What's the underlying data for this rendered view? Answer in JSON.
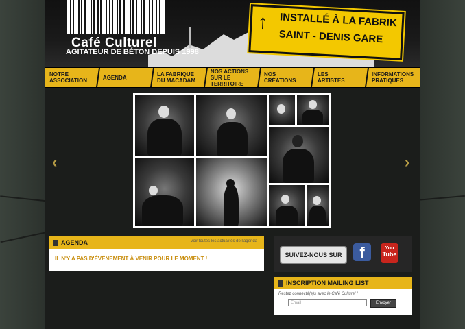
{
  "header": {
    "logo_main": "Café Culturel",
    "logo_sub": "AGITATEUR DE BÉTON DEPUIS 1998",
    "sign_line1": "INSTALLÉ À LA FABRIK",
    "sign_line2": "SAINT - DENIS GARE",
    "sign_arrow": "↑"
  },
  "nav": {
    "items": [
      {
        "label": "NOTRE ASSOCIATION"
      },
      {
        "label": "AGENDA"
      },
      {
        "label": "LA FABRIQUE DU MACADAM"
      },
      {
        "label": "NOS ACTIONS SUR LE TERRITOIRE"
      },
      {
        "label": "NOS CRÉATIONS"
      },
      {
        "label": "LES ARTISTES"
      },
      {
        "label": "INFORMATIONS PRATIQUES"
      }
    ]
  },
  "slider": {
    "prev": "‹",
    "next": "›"
  },
  "agenda": {
    "title": "AGENDA",
    "link": "Voir toutes les actualités de l'agenda",
    "empty": "IL N'Y A PAS D'ÉVÉNEMENT À VENIR POUR LE MOMENT !"
  },
  "social": {
    "follow": "SUIVEZ-NOUS SUR",
    "facebook": "f",
    "youtube_you": "You",
    "youtube_tube": "Tube"
  },
  "mailing": {
    "title": "INSCRIPTION MAILING LIST",
    "text": "Restez connecté(e)s avec le Café Culturel !",
    "email_placeholder": "Email",
    "send": "Envoyer"
  },
  "colors": {
    "accent": "#e7b51a",
    "page_bg": "#1b1d1b"
  }
}
